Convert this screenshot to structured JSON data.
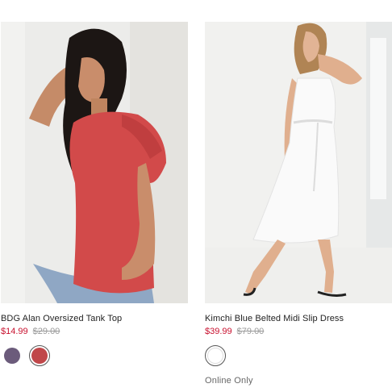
{
  "products": [
    {
      "name": "BDG Alan Oversized Tank Top",
      "sale_price": "$14.99",
      "original_price": "$29.00",
      "swatches": [
        {
          "color": "#6b5b7b",
          "selected": false
        },
        {
          "color": "#c0474a",
          "selected": true
        }
      ]
    },
    {
      "name": "Kimchi Blue Belted Midi Slip Dress",
      "sale_price": "$39.99",
      "original_price": "$79.00",
      "swatches": [
        {
          "color": "#ffffff",
          "selected": true
        }
      ],
      "availability": "Online Only"
    }
  ],
  "colors": {
    "sale": "#c8102e",
    "original": "#9a9a9a"
  }
}
